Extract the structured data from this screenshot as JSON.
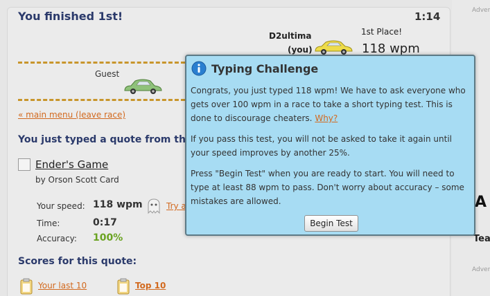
{
  "race": {
    "finished_text": "You finished 1st!",
    "timer": "1:14",
    "racer_name": "D2ultima",
    "racer_you": "(you)",
    "place": "1st Place!",
    "racer_wpm": "118 wpm",
    "guest_name": "Guest",
    "main_menu_link": "« main menu (leave race)"
  },
  "quote": {
    "heading": "You just typed a quote from the",
    "book_title": "Ender's Game",
    "author": "by Orson Scott Card"
  },
  "stats": {
    "speed_label": "Your speed:",
    "speed_value": "118 wpm",
    "time_label": "Time:",
    "time_value": "0:17",
    "accuracy_label": "Accuracy:",
    "accuracy_value": "100%",
    "try_link": "Try a"
  },
  "scores": {
    "heading": "Scores for this quote:",
    "last10": "Your last 10",
    "top10": "Top 10"
  },
  "sidebar": {
    "adv_top": "Adver",
    "adv_bottom": "Adver",
    "big_letter": "A",
    "tea_text": "Tea"
  },
  "modal": {
    "title": "Typing Challenge",
    "p1": "Congrats, you just typed 118 wpm! We have to ask everyone who gets over 100 wpm in a race to take a short typing test. This is done to discourage cheaters.",
    "why_link": "Why?",
    "p2": "If you pass this test, you will not be asked to take it again until your speed improves by another 25%.",
    "p3": "Press \"Begin Test\" when you are ready to start. You will need to type at least 88 wpm to pass. Don't worry about accuracy – some mistakes are allowed.",
    "begin_button": "Begin Test"
  },
  "icons": {
    "info": "info-icon",
    "car_user": "yellow-car-icon",
    "car_guest": "green-car-icon",
    "ghost": "ghost-icon",
    "clipboard": "clipboard-icon",
    "book_image": "broken-image-icon"
  },
  "colors": {
    "heading_blue": "#2b3a6b",
    "link_orange": "#d2691e",
    "track_gold": "#c8952b",
    "modal_bg": "#a7dcf3",
    "accuracy_green": "#6aa321"
  }
}
